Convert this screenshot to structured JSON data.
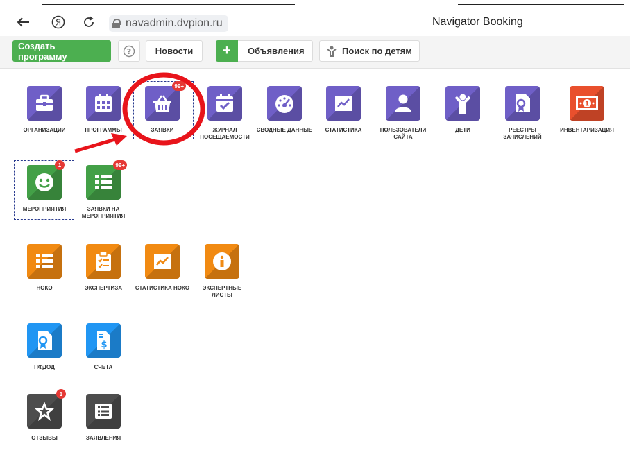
{
  "browser": {
    "url": "navadmin.dvpion.ru",
    "page_title": "Navigator Booking",
    "back_icon": "arrow-left-icon",
    "yandex_icon": "yandex-icon",
    "reload_icon": "reload-icon"
  },
  "toolbar": {
    "create_program": "Создать программу",
    "help_icon": "question-circle-icon",
    "news": "Новости",
    "announcements": "Объявления",
    "search_children": "Поиск по детям"
  },
  "tiles": {
    "organizations": "ОРГАНИЗАЦИИ",
    "programs": "ПРОГРАММЫ",
    "applications": "ЗАЯВКИ",
    "applications_badge": "99+",
    "attendance_journal": "ЖУРНАЛ ПОСЕЩАЕМОСТИ",
    "summary_data": "СВОДНЫЕ ДАННЫЕ",
    "statistics": "СТАТИСТИКА",
    "site_users": "ПОЛЬЗОВАТЕЛИ САЙТА",
    "children": "ДЕТИ",
    "enrollment_registers": "РЕЕСТРЫ ЗАЧИСЛЕНИЙ",
    "inventory": "ИНВЕНТАРИЗАЦИЯ",
    "events": "МЕРОПРИЯТИЯ",
    "events_badge": "1",
    "event_applications": "ЗАЯВКИ НА МЕРОПРИЯТИЯ",
    "event_applications_badge": "99+",
    "noko": "НОКО",
    "expertise": "ЭКСПЕРТИЗА",
    "noko_statistics": "СТАТИСТИКА НОКО",
    "expert_sheets": "ЭКСПЕРТНЫЕ ЛИСТЫ",
    "pfdo": "ПФДОД",
    "invoices": "СЧЕТА",
    "reviews": "ОТЗЫВЫ",
    "reviews_badge": "1",
    "statements": "ЗАЯВЛЕНИЯ"
  },
  "colors": {
    "purple": "#6f5fc7",
    "green": "#43a047",
    "orange": "#f18a12",
    "blue": "#2196f3",
    "gray": "#4d4d4d",
    "inventory": "#e9502d",
    "annotation_red": "#e8141b"
  }
}
